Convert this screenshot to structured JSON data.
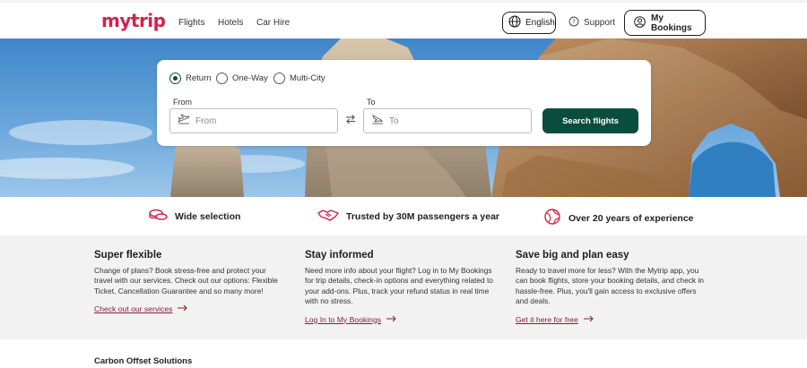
{
  "header": {
    "logo": "mytrip",
    "nav": [
      "Flights",
      "Hotels",
      "Car Hire"
    ],
    "language_label": "English",
    "support_label": "Support",
    "bookings_label": "My Bookings"
  },
  "search": {
    "trip_types": [
      "Return",
      "One-Way",
      "Multi-City"
    ],
    "selected_trip_type": "Return",
    "from_label": "From",
    "from_placeholder": "From",
    "to_label": "To",
    "to_placeholder": "To",
    "search_button": "Search flights"
  },
  "features": [
    {
      "icon": "coins-icon",
      "label": "Wide selection"
    },
    {
      "icon": "handshake-icon",
      "label": "Trusted by 30M passengers a year"
    },
    {
      "icon": "globe-icon",
      "label": "Over 20 years of experience"
    }
  ],
  "info": [
    {
      "title": "Super flexible",
      "body": "Change of plans? Book stress-free and protect your travel with our services. Check out our options: Flexible Ticket, Cancellation Guarantee and so many more!",
      "link": "Check out our services"
    },
    {
      "title": "Stay informed",
      "body": "Need more info about your flight? Log in to My Bookings for trip details, check-in options and everything related to your add-ons. Plus, track your refund status in real time with no stress.",
      "link": "Log In to My Bookings"
    },
    {
      "title": "Save big and plan easy",
      "body": "Ready to travel more for less? With the Mytrip app, you can book flights, store your booking details, and check in hassle-free. Plus, you'll gain access to exclusive offers and deals.",
      "link": "Get it here for free"
    }
  ],
  "bottom_title": "Carbon Offset Solutions",
  "colors": {
    "brand": "#d3204c",
    "primary_button": "#0b4d3c",
    "link": "#8b1a3a",
    "section_bg": "#f2f2f2"
  }
}
